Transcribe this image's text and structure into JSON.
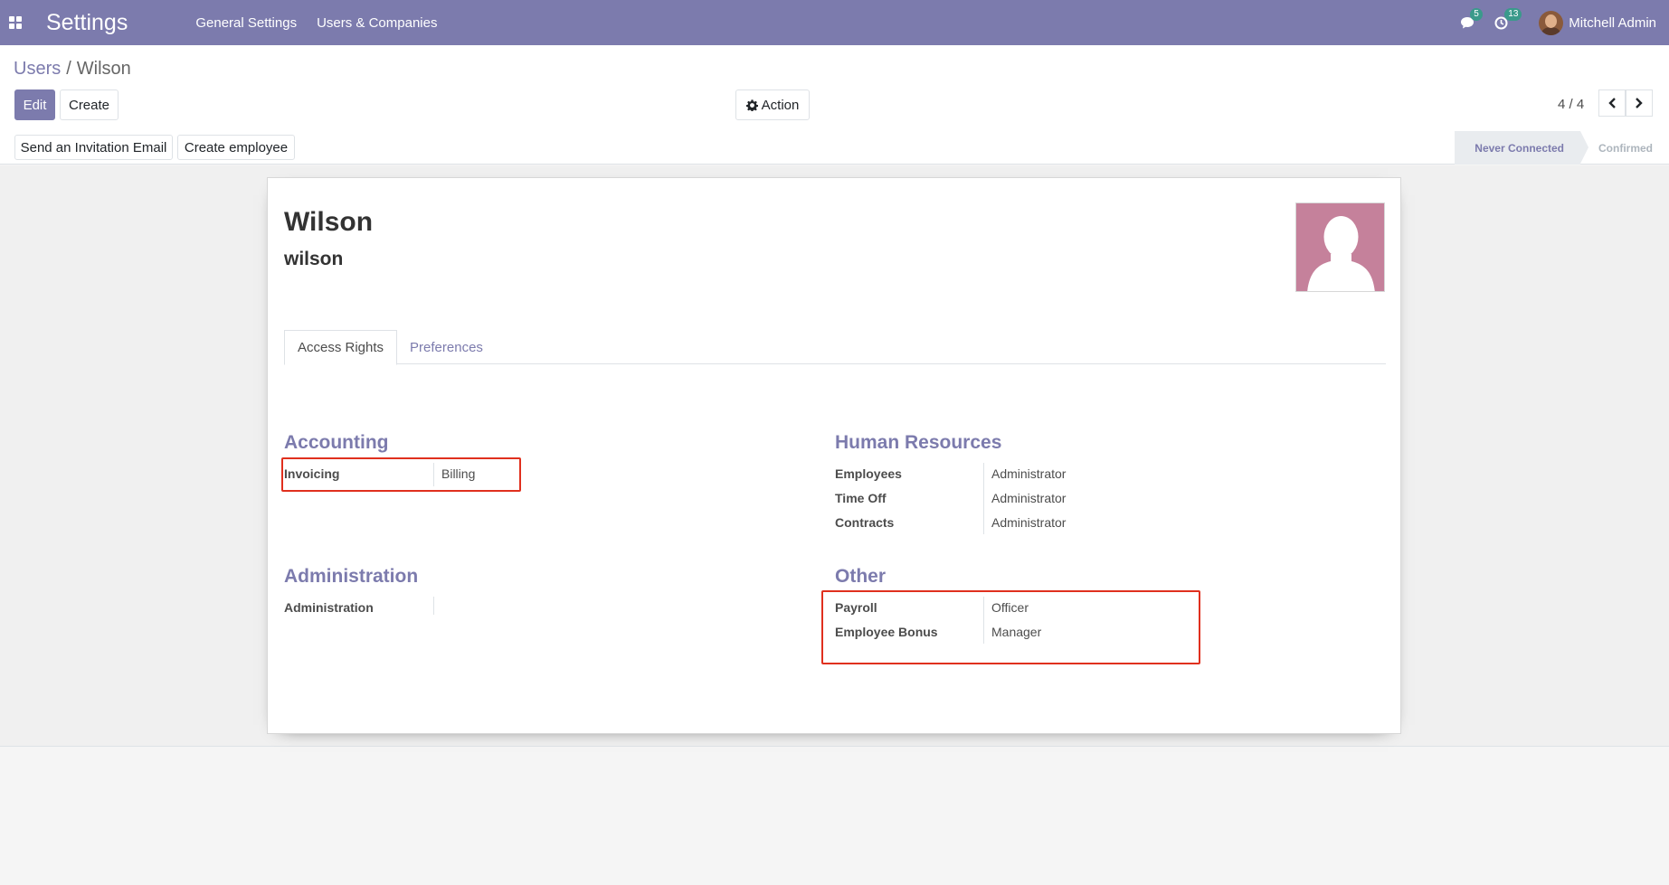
{
  "navbar": {
    "app_title": "Settings",
    "menu": [
      "General Settings",
      "Users & Companies"
    ],
    "messages_count": "5",
    "activities_count": "13",
    "user_name": "Mitchell Admin"
  },
  "breadcrumb": {
    "parent": "Users",
    "separator": "/",
    "current": "Wilson"
  },
  "buttons": {
    "edit": "Edit",
    "create": "Create",
    "action": "Action",
    "send_invitation": "Send an Invitation Email",
    "create_employee": "Create employee"
  },
  "pager": {
    "value": "4 / 4"
  },
  "status": {
    "steps": [
      "Never Connected",
      "Confirmed"
    ],
    "current": "Never Connected"
  },
  "record": {
    "name": "Wilson",
    "login": "wilson"
  },
  "tabs": [
    "Access Rights",
    "Preferences"
  ],
  "groups": {
    "accounting": {
      "title": "Accounting",
      "fields": [
        {
          "label": "Invoicing",
          "value": "Billing"
        }
      ]
    },
    "administration": {
      "title": "Administration",
      "fields": [
        {
          "label": "Administration",
          "value": ""
        }
      ]
    },
    "human_resources": {
      "title": "Human Resources",
      "fields": [
        {
          "label": "Employees",
          "value": "Administrator"
        },
        {
          "label": "Time Off",
          "value": "Administrator"
        },
        {
          "label": "Contracts",
          "value": "Administrator"
        }
      ]
    },
    "other": {
      "title": "Other",
      "fields": [
        {
          "label": "Payroll",
          "value": "Officer"
        },
        {
          "label": "Employee Bonus",
          "value": "Manager"
        }
      ]
    }
  },
  "colors": {
    "brand": "#7c7bad",
    "highlight": "#e0301e",
    "avatar_placeholder": "#c5819b"
  },
  "icons": [
    "apps-grid-icon",
    "chat-icon",
    "clock-icon",
    "gear-icon",
    "chevron-left-icon",
    "chevron-right-icon",
    "user-placeholder-icon"
  ]
}
